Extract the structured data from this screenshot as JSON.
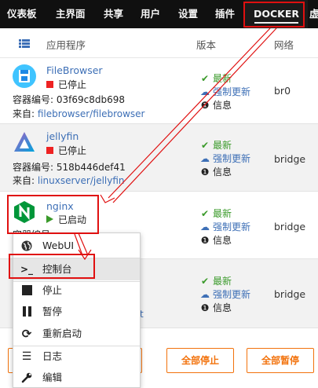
{
  "nav": {
    "items": [
      {
        "label": "仪表板",
        "name": "nav-dashboard"
      },
      {
        "label": "主界面",
        "name": "nav-main"
      },
      {
        "label": "共享",
        "name": "nav-shares"
      },
      {
        "label": "用户",
        "name": "nav-users"
      },
      {
        "label": "设置",
        "name": "nav-settings"
      },
      {
        "label": "插件",
        "name": "nav-plugins"
      },
      {
        "label": "DOCKER",
        "name": "nav-docker"
      },
      {
        "label": "虚",
        "name": "nav-vms"
      }
    ],
    "active": "DOCKER"
  },
  "table": {
    "col_app": "应用程序",
    "col_version": "版本",
    "col_network": "网络"
  },
  "containers": [
    {
      "name": "FileBrowser",
      "state": "已停止",
      "id_label": "容器编号:",
      "id": "03f69c8db698",
      "from_label": "来自:",
      "from": "filebrowser/filebrowser",
      "network": "br0"
    },
    {
      "name": "jellyfin",
      "state": "已停止",
      "id_label": "容器编号:",
      "id": "518b446def41",
      "from_label": "来自:",
      "from": "linuxserver/jellyfin",
      "network": "bridge"
    },
    {
      "name": "nginx",
      "state": "已启动",
      "id_label": "容器编号:",
      "id": "...",
      "network": "bridge"
    },
    {
      "name": "",
      "network": "bridge",
      "from_tail": "t"
    }
  ],
  "version": {
    "latest": "最新",
    "force_update": "强制更新",
    "info": "信息"
  },
  "buttons": {
    "stop_all": "全部停止",
    "pause_all": "全部暂停"
  },
  "context_menu": {
    "items": [
      {
        "label": "WebUI",
        "icon": "globe-icon"
      },
      {
        "label": "控制台",
        "icon": "console-icon"
      },
      {
        "label": "停止",
        "icon": "stop-icon"
      },
      {
        "label": "暂停",
        "icon": "pause-icon"
      },
      {
        "label": "重新启动",
        "icon": "restart-icon"
      },
      {
        "label": "日志",
        "icon": "list-icon"
      },
      {
        "label": "编辑",
        "icon": "wrench-icon"
      }
    ]
  },
  "colors": {
    "nav_bg": "#101010",
    "accent_orange": "#f2720c",
    "link_blue": "#3d6fb6",
    "ok_green": "#3a9a2a",
    "stopped_red": "#e22222",
    "annotation_red": "#e01010"
  }
}
